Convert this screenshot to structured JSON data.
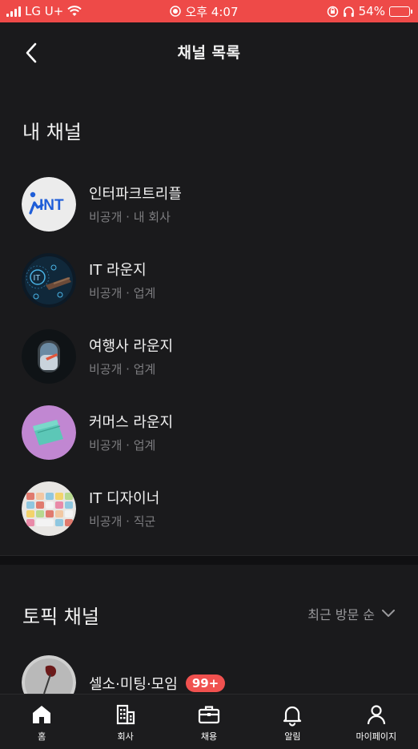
{
  "status_bar": {
    "carrier": "LG U+",
    "time": "오후 4:07",
    "battery": "54%",
    "battery_level": 0.54
  },
  "header": {
    "title": "채널 목록",
    "back_icon": "chevron-left-icon"
  },
  "my_channels": {
    "title": "내 채널",
    "items": [
      {
        "name": "인터파크트리플",
        "sub": "비공개 · 내 회사",
        "avatar": "INT"
      },
      {
        "name": "IT 라운지",
        "sub": "비공개 · 업계",
        "avatar": "IT"
      },
      {
        "name": "여행사 라운지",
        "sub": "비공개 · 업계",
        "avatar": "airplane-window"
      },
      {
        "name": "커머스 라운지",
        "sub": "비공개 · 업계",
        "avatar": "wallet"
      },
      {
        "name": "IT 디자이너",
        "sub": "비공개 · 직군",
        "avatar": "keyboard"
      }
    ]
  },
  "topic_channels": {
    "title": "토픽 채널",
    "sort_label": "최근 방문 순",
    "items": [
      {
        "name": "셀소·미팅·모임",
        "badge": "99+"
      }
    ]
  },
  "bottom_nav": [
    {
      "label": "홈",
      "icon": "home-icon"
    },
    {
      "label": "회사",
      "icon": "building-icon"
    },
    {
      "label": "채용",
      "icon": "briefcase-icon"
    },
    {
      "label": "알림",
      "icon": "bell-icon"
    },
    {
      "label": "마이페이지",
      "icon": "person-icon"
    }
  ],
  "colors": {
    "status_bar": "#ee4a48",
    "background": "#1a1a1c",
    "badge": "#f0514f"
  }
}
